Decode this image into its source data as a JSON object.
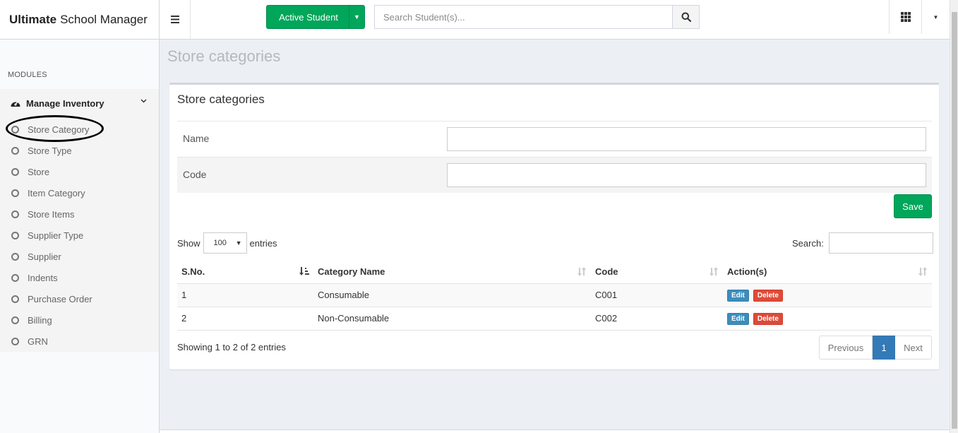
{
  "header": {
    "brand_bold": "Ultimate",
    "brand_rest": "School Manager",
    "active_student_label": "Active Student",
    "search_placeholder": "Search Student(s)..."
  },
  "sidebar": {
    "section_title": "MODULES",
    "group_label": "Manage Inventory",
    "items": [
      "Store Category",
      "Store Type",
      "Store",
      "Item Category",
      "Store Items",
      "Supplier Type",
      "Supplier",
      "Indents",
      "Purchase Order",
      "Billing",
      "GRN"
    ]
  },
  "page": {
    "title": "Store categories",
    "card_title": "Store categories",
    "form": {
      "name_label": "Name",
      "name_value": "",
      "code_label": "Code",
      "code_value": "",
      "save_label": "Save"
    },
    "table_controls": {
      "show_label": "Show",
      "entries_value": "100",
      "entries_label": "entries",
      "search_label": "Search:"
    },
    "columns": [
      "S.No.",
      "Category Name",
      "Code",
      "Action(s)"
    ],
    "rows": [
      {
        "sno": "1",
        "name": "Consumable",
        "code": "C001"
      },
      {
        "sno": "2",
        "name": "Non-Consumable",
        "code": "C002"
      }
    ],
    "row_actions": {
      "edit": "Edit",
      "delete": "Delete"
    },
    "info": "Showing 1 to 2 of 2 entries",
    "pagination": {
      "previous": "Previous",
      "current": "1",
      "next": "Next"
    }
  },
  "colors": {
    "success": "#00a65a",
    "primary": "#337ab7",
    "danger": "#dd4b39",
    "edit": "#3c8dbc"
  }
}
